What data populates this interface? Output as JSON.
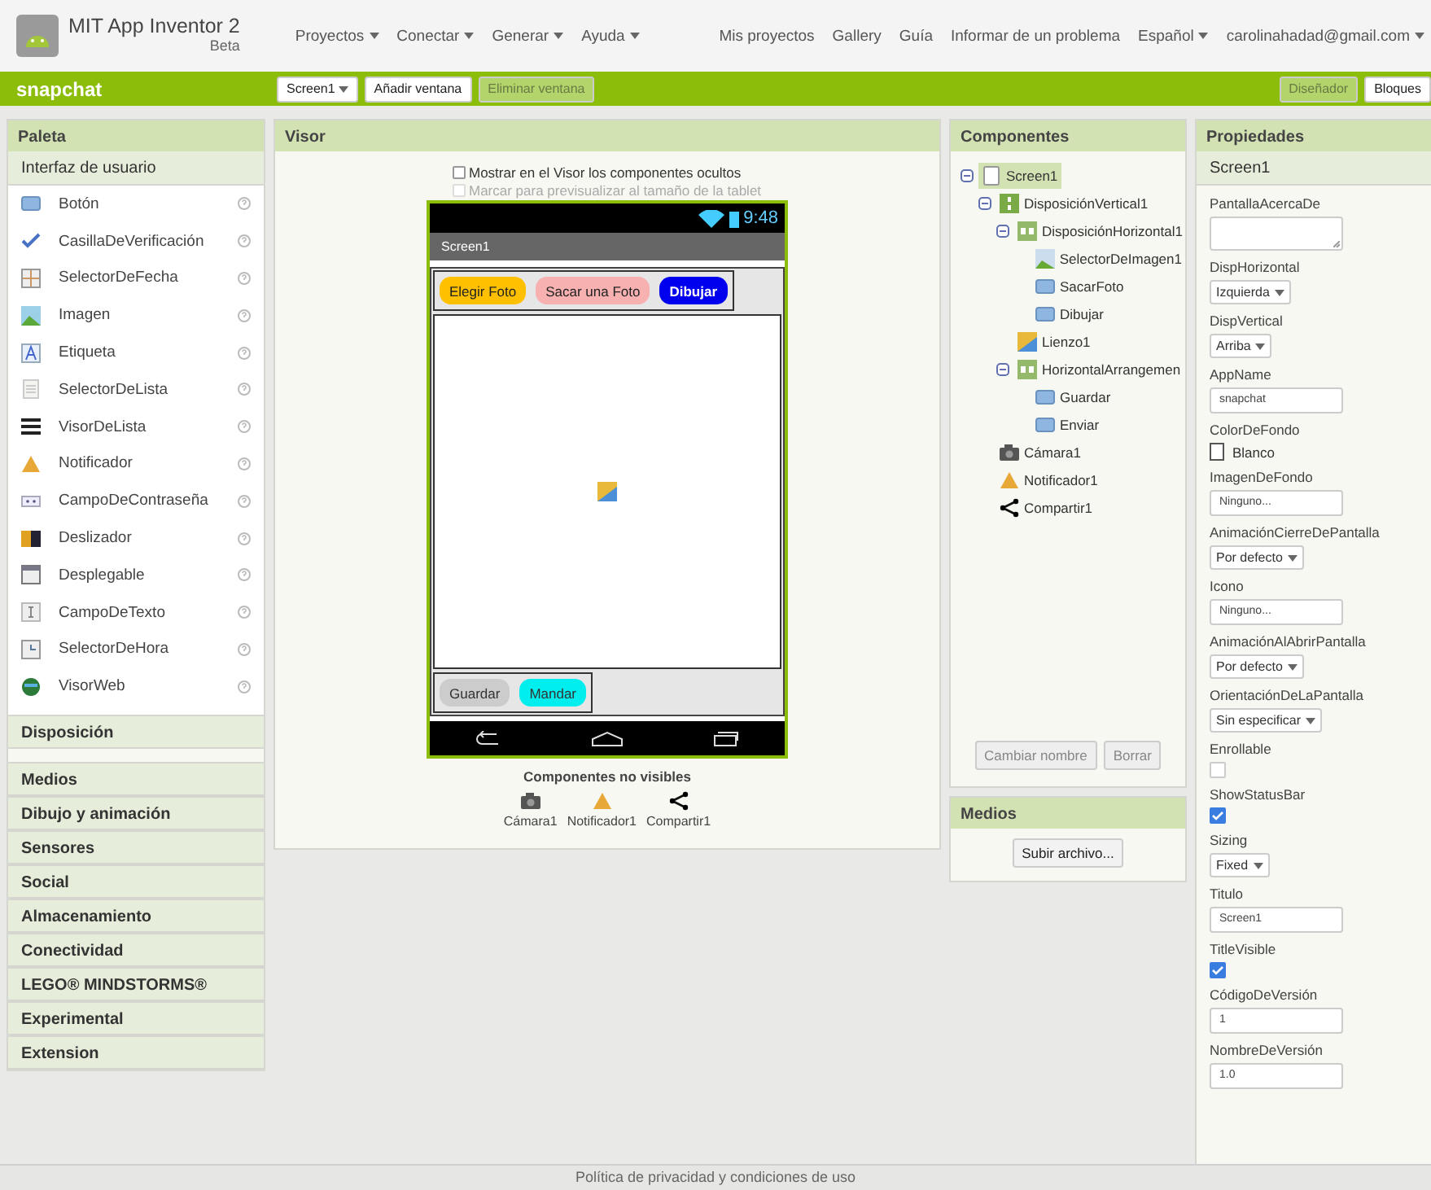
{
  "header": {
    "logo": {
      "title": "MIT App Inventor 2",
      "subtitle": "Beta"
    },
    "menus": [
      "Proyectos",
      "Conectar",
      "Generar",
      "Ayuda"
    ],
    "links": [
      "Mis proyectos",
      "Gallery",
      "Guía",
      "Informar de un problema"
    ],
    "language": "Español",
    "account": "carolinahadad@gmail.com"
  },
  "project_bar": {
    "project_name": "snapchat",
    "screen_selector": "Screen1",
    "buttons": [
      {
        "label": "Añadir ventana",
        "disabled": false
      },
      {
        "label": "Eliminar ventana",
        "disabled": true
      }
    ],
    "view_tabs": [
      {
        "label": "Diseñador",
        "selected": true
      },
      {
        "label": "Bloques",
        "selected": false
      }
    ]
  },
  "palette": {
    "title": "Paleta",
    "open_category": "Interfaz de usuario",
    "items": [
      {
        "label": "Botón",
        "kind": "button"
      },
      {
        "label": "CasillaDeVerificación",
        "kind": "checkbox"
      },
      {
        "label": "SelectorDeFecha",
        "kind": "datepicker"
      },
      {
        "label": "Imagen",
        "kind": "image"
      },
      {
        "label": "Etiqueta",
        "kind": "label"
      },
      {
        "label": "SelectorDeLista",
        "kind": "listpicker"
      },
      {
        "label": "VisorDeLista",
        "kind": "listview"
      },
      {
        "label": "Notificador",
        "kind": "notifier"
      },
      {
        "label": "CampoDeContraseña",
        "kind": "password"
      },
      {
        "label": "Deslizador",
        "kind": "slider"
      },
      {
        "label": "Desplegable",
        "kind": "spinner"
      },
      {
        "label": "CampoDeTexto",
        "kind": "textbox"
      },
      {
        "label": "SelectorDeHora",
        "kind": "timepicker"
      },
      {
        "label": "VisorWeb",
        "kind": "webviewer"
      }
    ],
    "categories": [
      "Disposición",
      "Medios",
      "Dibujo y animación",
      "Sensores",
      "Social",
      "Almacenamiento",
      "Conectividad",
      "LEGO® MINDSTORMS®",
      "Experimental",
      "Extension"
    ]
  },
  "viewer": {
    "title": "Visor",
    "checkboxes": [
      {
        "label": "Mostrar en el Visor los componentes ocultos",
        "checked": false,
        "disabled": false
      },
      {
        "label": "Marcar para previsualizar al tamaño de la tablet",
        "checked": false,
        "disabled": true
      }
    ],
    "phone": {
      "time": "9:48",
      "title": "Screen1",
      "top_buttons": [
        {
          "label": "Elegir Foto",
          "color": "#ffc000"
        },
        {
          "label": "Sacar una Foto",
          "color": "#f7b1b1"
        },
        {
          "label": "Dibujar",
          "color": "#0000ee"
        }
      ],
      "bottom_buttons": [
        {
          "label": "Guardar",
          "color": "#cccccc"
        },
        {
          "label": "Mandar",
          "color": "#00eeee"
        }
      ]
    },
    "non_visible_title": "Componentes no visibles",
    "non_visible": [
      {
        "label": "Cámara1",
        "kind": "camera"
      },
      {
        "label": "Notificador1",
        "kind": "notifier"
      },
      {
        "label": "Compartir1",
        "kind": "sharing"
      }
    ]
  },
  "components": {
    "title": "Componentes",
    "tree": [
      {
        "label": "Screen1",
        "kind": "screen",
        "selected": true,
        "expanded": true,
        "children": [
          {
            "label": "DisposiciónVertical1",
            "kind": "vertical",
            "selected": false,
            "expanded": true,
            "children": [
              {
                "label": "DisposiciónHorizontal1",
                "kind": "horizontal",
                "selected": false,
                "expanded": true,
                "children": [
                  {
                    "label": "SelectorDeImagen1",
                    "kind": "imagepicker",
                    "selected": false
                  },
                  {
                    "label": "SacarFoto",
                    "kind": "button",
                    "selected": false
                  },
                  {
                    "label": "Dibujar",
                    "kind": "button",
                    "selected": false
                  }
                ]
              },
              {
                "label": "Lienzo1",
                "kind": "canvas",
                "selected": false
              },
              {
                "label": "HorizontalArrangemen",
                "kind": "horizontal",
                "selected": false,
                "expanded": true,
                "children": [
                  {
                    "label": "Guardar",
                    "kind": "button",
                    "selected": false
                  },
                  {
                    "label": "Enviar",
                    "kind": "button",
                    "selected": false
                  }
                ]
              }
            ]
          },
          {
            "label": "Cámara1",
            "kind": "camera",
            "selected": false
          },
          {
            "label": "Notificador1",
            "kind": "notifier",
            "selected": false
          },
          {
            "label": "Compartir1",
            "kind": "sharing",
            "selected": false
          }
        ]
      }
    ],
    "buttons": [
      {
        "label": "Cambiar nombre",
        "disabled": true
      },
      {
        "label": "Borrar",
        "disabled": true
      }
    ]
  },
  "media": {
    "title": "Medios",
    "upload_button": "Subir archivo..."
  },
  "properties": {
    "title": "Propiedades",
    "component": "Screen1",
    "items": [
      {
        "label": "PantallaAcercaDe",
        "kind": "textarea"
      },
      {
        "label": "DispHorizontal",
        "kind": "dropdown",
        "value": "Izquierda"
      },
      {
        "label": "DispVertical",
        "kind": "dropdown",
        "value": "Arriba"
      },
      {
        "label": "AppName",
        "kind": "text",
        "value": "snapchat"
      },
      {
        "label": "ColorDeFondo",
        "kind": "color",
        "value": "Blanco",
        "color": "#ffffff"
      },
      {
        "label": "ImagenDeFondo",
        "kind": "text",
        "value": "Ninguno..."
      },
      {
        "label": "AnimaciónCierreDePantalla",
        "kind": "dropdown",
        "value": "Por defecto"
      },
      {
        "label": "Icono",
        "kind": "text",
        "value": "Ninguno..."
      },
      {
        "label": "AnimaciónAlAbrirPantalla",
        "kind": "dropdown",
        "value": "Por defecto"
      },
      {
        "label": "OrientaciónDeLaPantalla",
        "kind": "dropdown",
        "value": "Sin especificar"
      },
      {
        "label": "Enrollable",
        "kind": "checkbox",
        "checked": false
      },
      {
        "label": "ShowStatusBar",
        "kind": "checkbox",
        "checked": true
      },
      {
        "label": "Sizing",
        "kind": "dropdown",
        "value": "Fixed"
      },
      {
        "label": "Titulo",
        "kind": "text",
        "value": "Screen1"
      },
      {
        "label": "TitleVisible",
        "kind": "checkbox",
        "checked": true
      },
      {
        "label": "CódigoDeVersión",
        "kind": "text",
        "value": "1"
      },
      {
        "label": "NombreDeVersión",
        "kind": "text",
        "value": "1.0"
      }
    ]
  },
  "footer": {
    "link": "Política de privacidad y condiciones de uso"
  }
}
